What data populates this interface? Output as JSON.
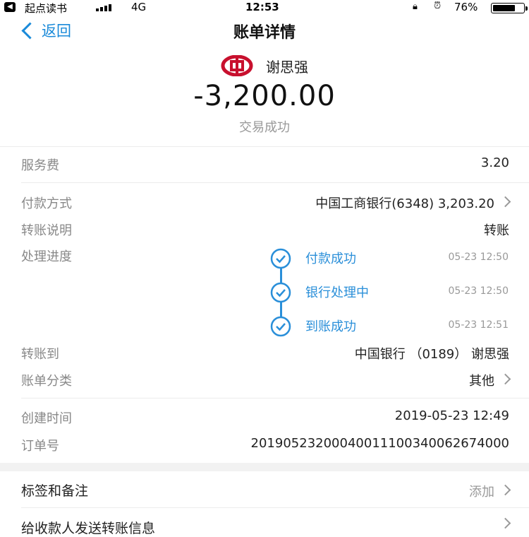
{
  "status_bar": {
    "back_app_label": "起点读书",
    "network": "4G",
    "time": "12:53",
    "battery": "76%",
    "battery_level": 0.76
  },
  "nav": {
    "back_label": "返回",
    "title": "账单详情"
  },
  "header": {
    "bank_logo": "bank-of-china-logo",
    "payee": "谢思强",
    "amount": "-3,200.00",
    "status": "交易成功"
  },
  "details": {
    "fee_label": "服务费",
    "fee_value": "3.20",
    "payment_method_label": "付款方式",
    "payment_method_value": "中国工商银行(6348) 3,203.20",
    "transfer_note_label": "转账说明",
    "transfer_note_value": "转账",
    "progress_label": "处理进度",
    "progress_steps": [
      {
        "label": "付款成功",
        "time": "05-23 12:50"
      },
      {
        "label": "银行处理中",
        "time": "05-23 12:50"
      },
      {
        "label": "到账成功",
        "time": "05-23 12:51"
      }
    ],
    "transfer_to_label": "转账到",
    "transfer_to_value": "中国银行 （0189） 谢思强",
    "category_label": "账单分类",
    "category_value": "其他",
    "created_label": "创建时间",
    "created_value": "2019-05-23 12:49",
    "order_label": "订单号",
    "order_value": "20190523200040011100340062674000"
  },
  "actions": {
    "tags_label": "标签和备注",
    "tags_action": "添加",
    "send_info_label": "给收款人发送转账信息"
  },
  "colors": {
    "accent": "#1a8ad9",
    "bank_red": "#c8102e"
  }
}
